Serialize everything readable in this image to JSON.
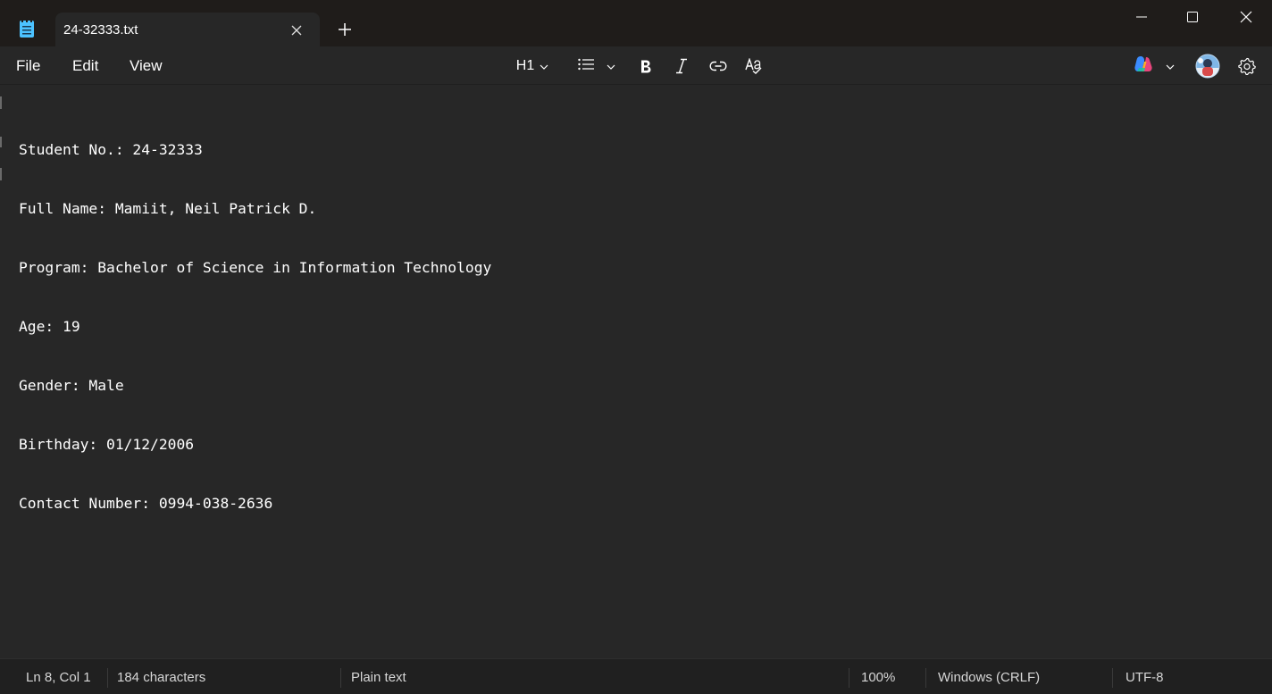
{
  "window": {
    "tab_title": "24-32333.txt"
  },
  "menu": {
    "file": "File",
    "edit": "Edit",
    "view": "View"
  },
  "toolbar": {
    "heading_label": "H1"
  },
  "document": {
    "lines": [
      "Student No.: 24-32333",
      "Full Name: Mamiit, Neil Patrick D.",
      "Program: Bachelor of Science in Information Technology",
      "Age: 19",
      "Gender: Male",
      "Birthday: 01/12/2006",
      "Contact Number: 0994-038-2636"
    ]
  },
  "status": {
    "position": "Ln 8, Col 1",
    "characters": "184 characters",
    "format": "Plain text",
    "zoom": "100%",
    "line_ending": "Windows (CRLF)",
    "encoding": "UTF-8"
  },
  "colors": {
    "titlebar": "#1f1c1a",
    "editor_bg": "#272727",
    "statusbar": "#202020",
    "text": "#ffffff",
    "app_icon": "#4cc2ff"
  },
  "icons": [
    "notepad-icon",
    "close-icon",
    "plus-icon",
    "minimize-icon",
    "maximize-icon",
    "chevron-down-icon",
    "list-icon",
    "bold-icon",
    "italic-icon",
    "link-icon",
    "spellcheck-icon",
    "copilot-icon",
    "avatar",
    "gear-icon"
  ]
}
